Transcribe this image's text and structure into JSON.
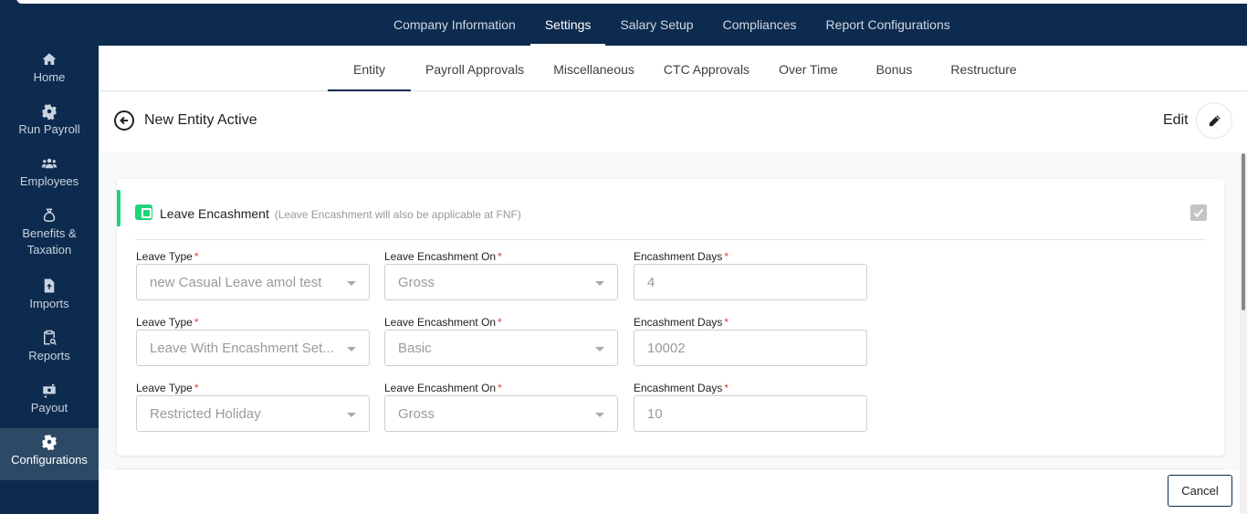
{
  "top_nav": {
    "tabs": [
      {
        "label": "Company Information",
        "active": false
      },
      {
        "label": "Settings",
        "active": true
      },
      {
        "label": "Salary Setup",
        "active": false
      },
      {
        "label": "Compliances",
        "active": false
      },
      {
        "label": "Report Configurations",
        "active": false
      }
    ]
  },
  "sidebar": {
    "items": [
      {
        "label": "Home",
        "icon": "home-icon",
        "active": false
      },
      {
        "label": "Run Payroll",
        "icon": "gear-icon",
        "active": false
      },
      {
        "label": "Employees",
        "icon": "users-icon",
        "active": false
      },
      {
        "label": "Benefits &",
        "label2": "Taxation",
        "icon": "money-bag-icon",
        "active": false
      },
      {
        "label": "Imports",
        "icon": "file-upload-icon",
        "active": false
      },
      {
        "label": "Reports",
        "icon": "clipboard-search-icon",
        "active": false
      },
      {
        "label": "Payout",
        "icon": "money-transfer-icon",
        "active": false
      },
      {
        "label": "Configurations",
        "icon": "gear-icon",
        "active": true
      }
    ]
  },
  "sub_nav": {
    "tabs": [
      {
        "label": "Entity",
        "active": true
      },
      {
        "label": "Payroll Approvals",
        "active": false
      },
      {
        "label": "Miscellaneous",
        "active": false
      },
      {
        "label": "CTC Approvals",
        "active": false
      },
      {
        "label": "Over Time",
        "active": false
      },
      {
        "label": "Bonus",
        "active": false
      },
      {
        "label": "Restructure",
        "active": false
      }
    ]
  },
  "header": {
    "title": "New Entity Active",
    "edit_label": "Edit"
  },
  "section": {
    "title": "Leave Encashment",
    "note": "(Leave Encashment will also be applicable at FNF)",
    "enabled": true,
    "accent_color": "#1dd47a",
    "labels": {
      "leave_type": "Leave Type",
      "encashment_on": "Leave Encashment On",
      "encashment_days": "Encashment Days",
      "required_mark": "*"
    },
    "rows": [
      {
        "leave_type": "new Casual Leave amol test",
        "encashment_on": "Gross",
        "encashment_days": "4"
      },
      {
        "leave_type": "Leave With Encashment Set...",
        "encashment_on": "Basic",
        "encashment_days": "10002"
      },
      {
        "leave_type": "Restricted Holiday",
        "encashment_on": "Gross",
        "encashment_days": "10"
      }
    ]
  },
  "footer": {
    "cancel_label": "Cancel"
  },
  "colors": {
    "navy": "#0d2b4e",
    "sidebar_active": "#2c4a66",
    "required": "#e53935"
  }
}
